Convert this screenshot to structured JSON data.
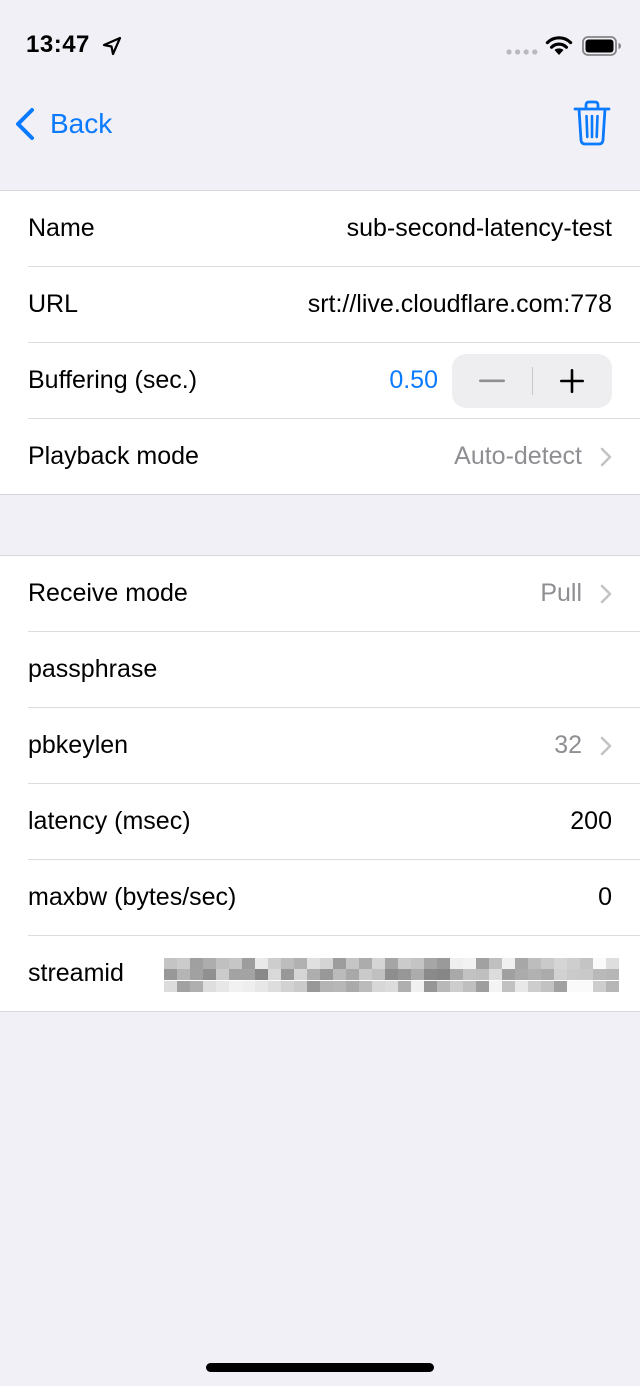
{
  "status_bar": {
    "time": "13:47"
  },
  "nav": {
    "back_label": "Back"
  },
  "section1": {
    "rows": [
      {
        "label": "Name",
        "value": "sub-second-latency-test"
      },
      {
        "label": "URL",
        "value": "srt://live.cloudflare.com:778"
      },
      {
        "label": "Buffering (sec.)",
        "value": "0.50"
      },
      {
        "label": "Playback mode",
        "value": "Auto-detect"
      }
    ]
  },
  "section2": {
    "rows": [
      {
        "label": "Receive mode",
        "value": "Pull"
      },
      {
        "label": "passphrase",
        "value": ""
      },
      {
        "label": "pbkeylen",
        "value": "32"
      },
      {
        "label": "latency (msec)",
        "value": "200"
      },
      {
        "label": "maxbw (bytes/sec)",
        "value": "0"
      },
      {
        "label": "streamid",
        "value": ""
      }
    ]
  },
  "colors": {
    "accent": "#0a7aff",
    "background": "#f1f0f6",
    "secondary_text": "#8e8e93"
  },
  "icons": {
    "location": "location-arrow-icon",
    "signal": "cellular-signal-icon",
    "wifi": "wifi-icon",
    "battery": "battery-icon",
    "back": "chevron-left-icon",
    "trash": "trash-icon",
    "chevron": "chevron-right-icon",
    "minus": "minus-icon",
    "plus": "plus-icon"
  }
}
